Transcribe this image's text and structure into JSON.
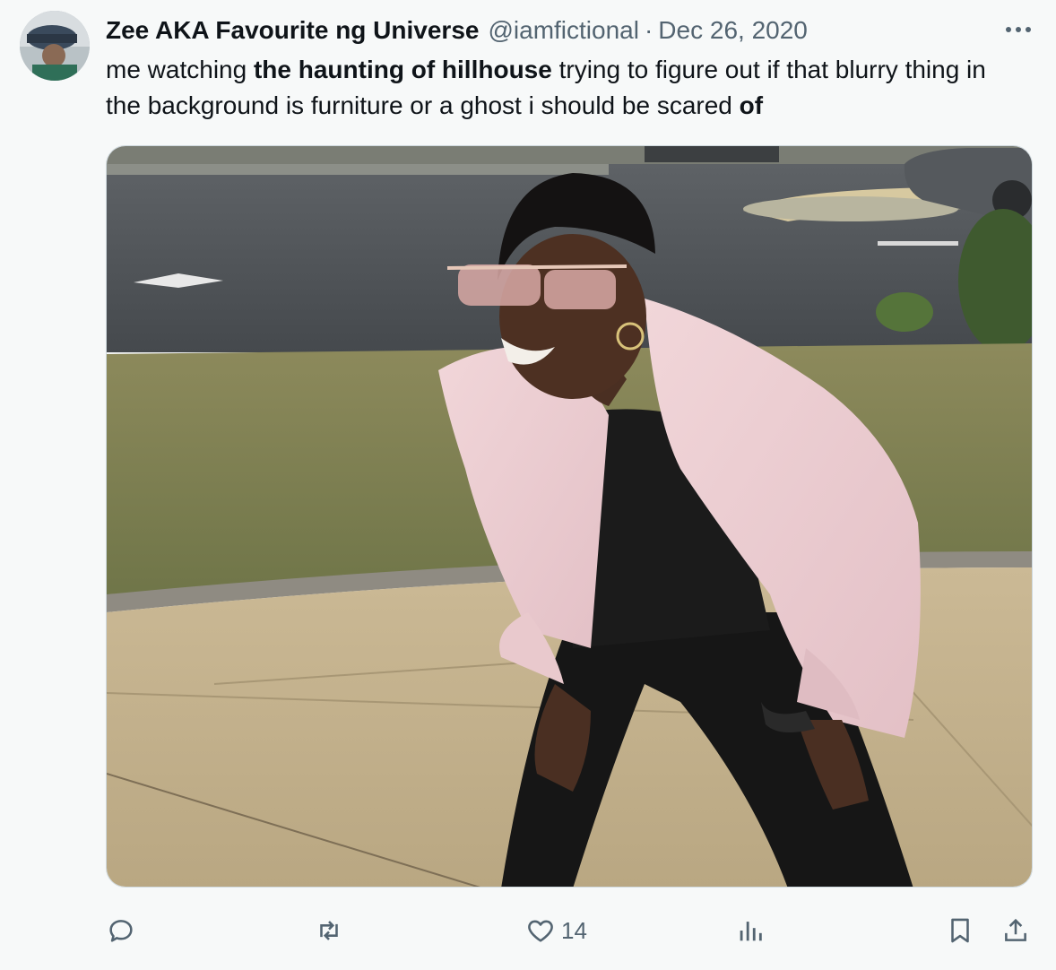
{
  "tweet": {
    "display_name": "Zee AKA Favourite ng Universe",
    "handle": "@iamfictional",
    "separator": "·",
    "date": "Dec 26, 2020",
    "text_parts": [
      "me watching ",
      "the haunting of hillhouse",
      " trying to figure out if that blurry thing in the background is furniture or a ghost i should be scared ",
      "of"
    ]
  },
  "actions": {
    "reply": {
      "icon": "reply-icon",
      "count": ""
    },
    "retweet": {
      "icon": "retweet-icon",
      "count": ""
    },
    "like": {
      "icon": "heart-icon",
      "count": "14"
    },
    "views": {
      "icon": "views-icon",
      "count": ""
    },
    "bookmark": {
      "icon": "bookmark-icon"
    },
    "share": {
      "icon": "share-icon"
    }
  },
  "colors": {
    "background": "#f7f9f9",
    "text": "#0f1419",
    "secondary": "#536471"
  }
}
